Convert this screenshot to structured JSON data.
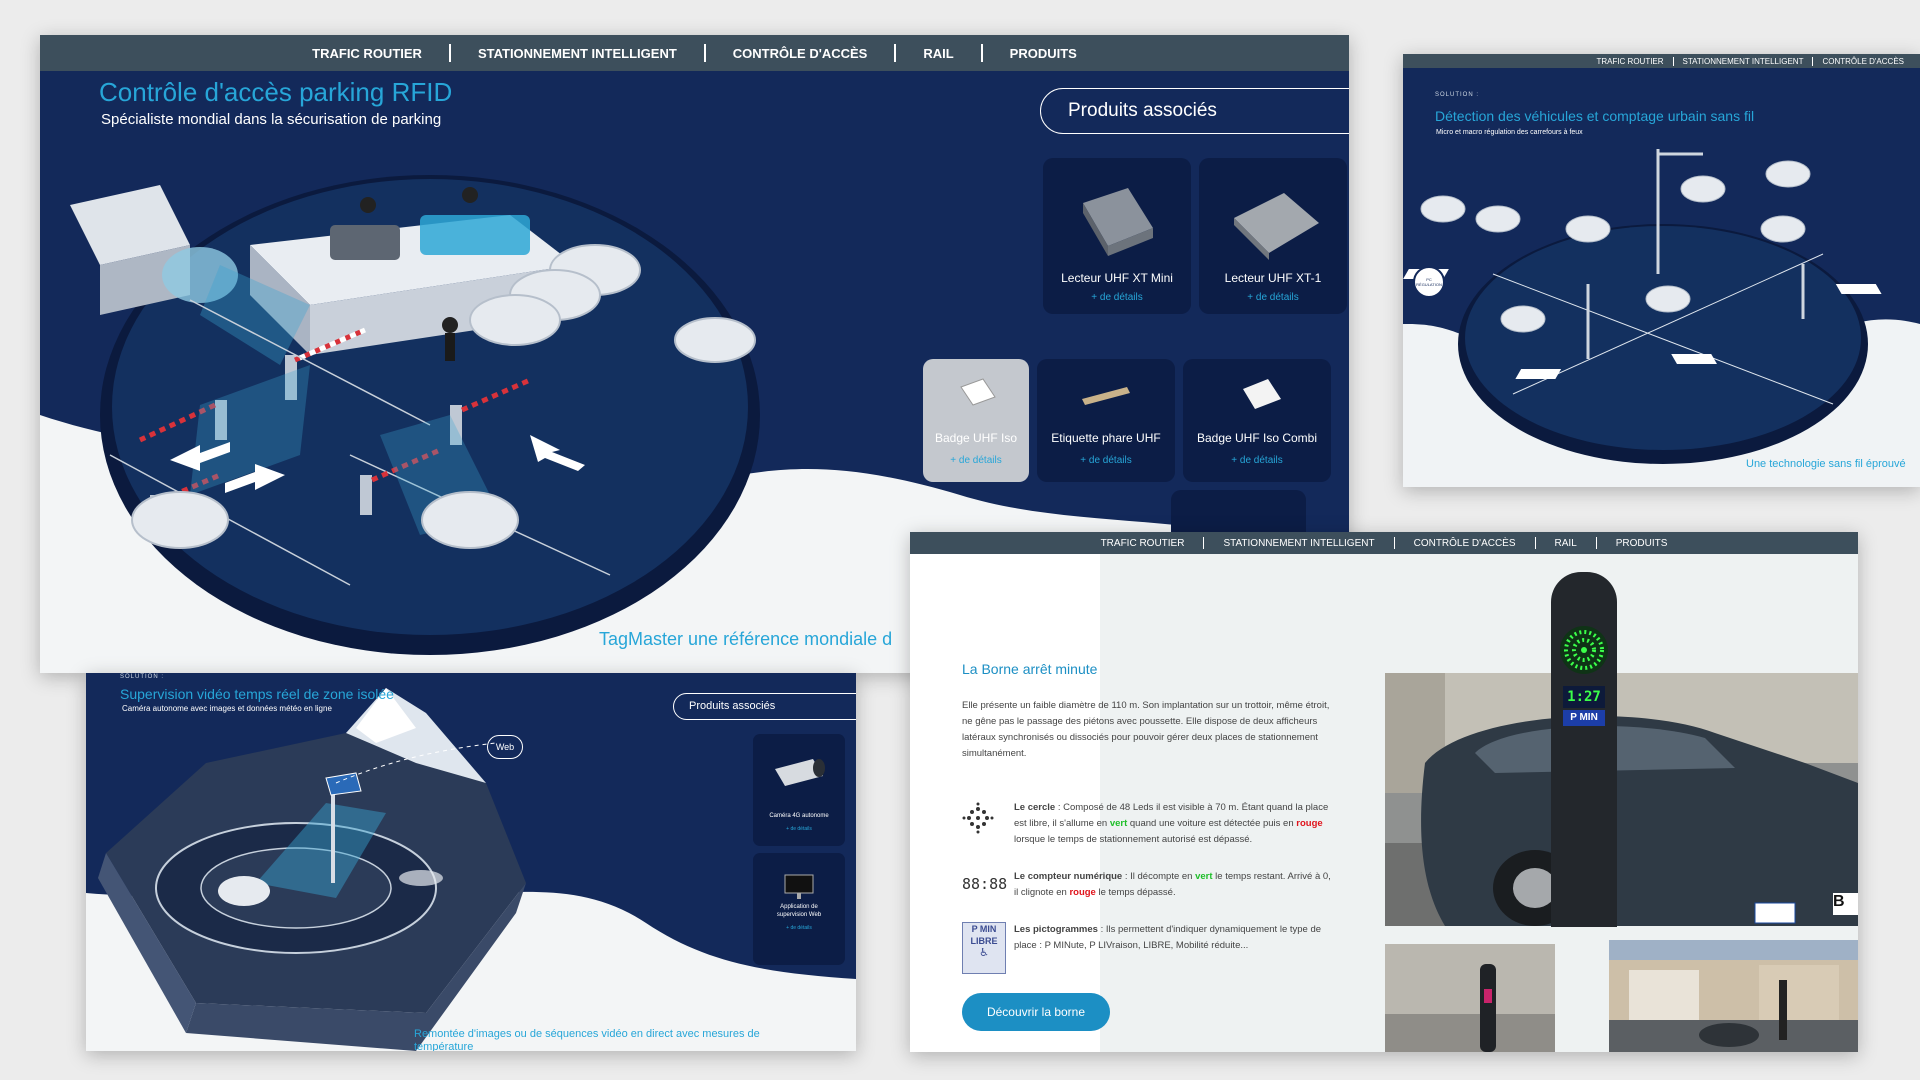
{
  "nav": {
    "items": [
      "TRAFIC ROUTIER",
      "STATIONNEMENT INTELLIGENT",
      "CONTRÔLE D'ACCÈS",
      "RAIL",
      "PRODUITS"
    ]
  },
  "panel1": {
    "title": "Contrôle d'accès parking RFID",
    "subtitle": "Spécialiste mondial dans la sécurisation de parking",
    "related_button": "Produits associés",
    "footer_text": "TagMaster une référence mondiale d",
    "products": [
      {
        "label": "Lecteur UHF XT Mini",
        "details": "+ de détails"
      },
      {
        "label": "Lecteur UHF XT-1",
        "details": "+ de détails"
      },
      {
        "label": "Badge UHF Iso",
        "details": "+ de détails"
      },
      {
        "label": "Etiquette phare UHF",
        "details": "+ de détails"
      },
      {
        "label": "Badge UHF Iso Combi",
        "details": "+ de détails"
      }
    ]
  },
  "panel2": {
    "nav_items": [
      "TRAFIC ROUTIER",
      "STATIONNEMENT INTELLIGENT",
      "CONTRÔLE D'ACCÈS"
    ],
    "kicker": "SOLUTION :",
    "title": "Détection des véhicules et comptage urbain sans fil",
    "subtitle": "Micro et macro régulation des carrefours à feux",
    "badge": "PC RÉGULATION",
    "footer_text": "Une technologie sans fil éprouvé"
  },
  "panel3": {
    "kicker": "SOLUTION :",
    "title": "Supervision vidéo temps réel de zone isolée",
    "subtitle": "Caméra autonome avec images et données météo en ligne",
    "related_button": "Produits associés",
    "web_label": "Web",
    "products": [
      {
        "label": "Caméra 4G autonome",
        "details": "+ de détails"
      },
      {
        "label": "Application de supervision Web",
        "details": "+ de détails"
      }
    ],
    "footer_text": "Remontée d'images ou de séquences vidéo en direct avec mesures de température"
  },
  "panel4": {
    "title": "La Borne arrêt minute",
    "intro": "Elle présente un faible diamètre de 110 m. Son implantation sur un trottoir, même étroit, ne gêne pas le passage des piétons avec poussette. Elle dispose de deux afficheurs latéraux synchronisés ou dissociés pour pouvoir gérer deux places de stationnement simultanément.",
    "features": [
      {
        "icon": "led-circle-icon",
        "name": "Le cercle",
        "t1": " : Composé de 48 Leds il est visible à 70 m. Étant quand la place est libre, il s'allume en ",
        "c1": "vert",
        "t2": " quand une voiture est détectée puis en ",
        "c2": "rouge",
        "t3": " lorsque le temps de stationnement autorisé est dépassé."
      },
      {
        "icon": "digital-counter-icon",
        "name": "Le compteur numérique",
        "t1": " : Il décompte en ",
        "c1": "vert",
        "t2": " le temps restant. Arrivé à 0, il clignote en ",
        "c2": "rouge",
        "t3": " le temps dépassé."
      },
      {
        "icon": "pictogram-icon",
        "name": "Les pictogrammes",
        "t1": " : Ils permettent d'indiquer dynamiquement le type de place : P MINute, P LIVraison, LIBRE, Mobilité réduite...",
        "c1": "",
        "t2": "",
        "c2": "",
        "t3": ""
      }
    ],
    "counter_glyph": "88:88",
    "picto_text": [
      "P MIN",
      "LIBRE"
    ],
    "display_time": "1:27",
    "display_p": "P MIN",
    "plate": "B",
    "button": "Découvrir la borne",
    "colors": {
      "green": "#1fbf2a",
      "red": "#e0141c",
      "accent": "#1c8fc4"
    }
  }
}
